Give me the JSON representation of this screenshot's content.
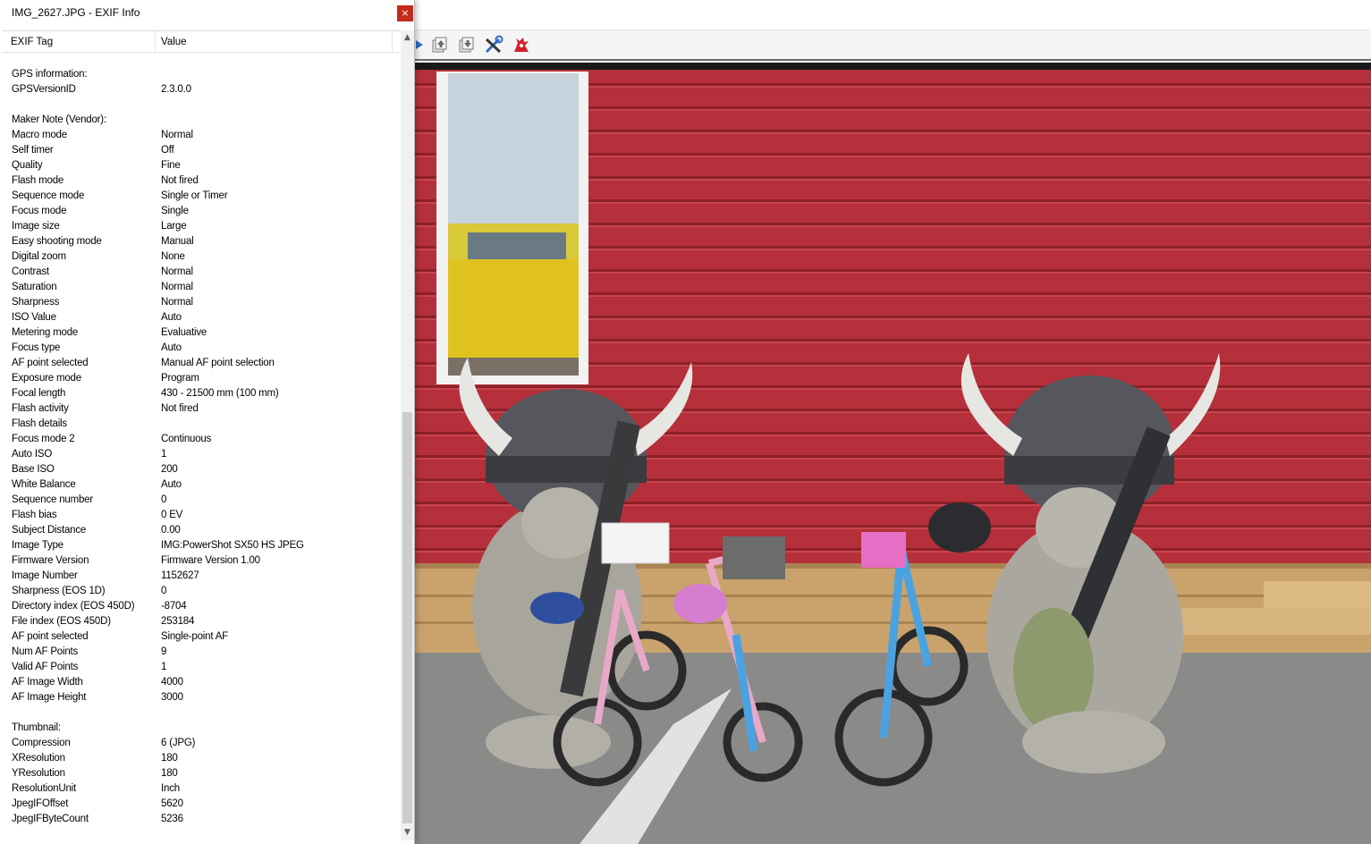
{
  "dialog": {
    "title": "IMG_2627.JPG - EXIF Info",
    "close_glyph": "×"
  },
  "columns": {
    "tag": "EXIF Tag",
    "value": "Value"
  },
  "rows": [
    {
      "tag": "",
      "value": ""
    },
    {
      "tag": "GPS information:",
      "value": ""
    },
    {
      "tag": "GPSVersionID",
      "value": "2.3.0.0"
    },
    {
      "tag": "",
      "value": ""
    },
    {
      "tag": "Maker Note (Vendor):",
      "value": ""
    },
    {
      "tag": "Macro mode",
      "value": "Normal"
    },
    {
      "tag": "Self timer",
      "value": "Off"
    },
    {
      "tag": "Quality",
      "value": "Fine"
    },
    {
      "tag": "Flash mode",
      "value": "Not fired"
    },
    {
      "tag": "Sequence mode",
      "value": "Single or Timer"
    },
    {
      "tag": "Focus mode",
      "value": "Single"
    },
    {
      "tag": "Image size",
      "value": "Large"
    },
    {
      "tag": "Easy shooting mode",
      "value": "Manual"
    },
    {
      "tag": "Digital zoom",
      "value": "None"
    },
    {
      "tag": "Contrast",
      "value": "Normal"
    },
    {
      "tag": "Saturation",
      "value": "Normal"
    },
    {
      "tag": "Sharpness",
      "value": "Normal"
    },
    {
      "tag": "ISO Value",
      "value": "Auto"
    },
    {
      "tag": "Metering mode",
      "value": "Evaluative"
    },
    {
      "tag": "Focus type",
      "value": "Auto"
    },
    {
      "tag": "AF point selected",
      "value": "Manual AF point selection"
    },
    {
      "tag": "Exposure mode",
      "value": "Program"
    },
    {
      "tag": "Focal length",
      "value": "430 - 21500 mm (100 mm)"
    },
    {
      "tag": "Flash activity",
      "value": "Not fired"
    },
    {
      "tag": "Flash details",
      "value": ""
    },
    {
      "tag": "Focus mode 2",
      "value": "Continuous"
    },
    {
      "tag": "Auto ISO",
      "value": "1"
    },
    {
      "tag": "Base ISO",
      "value": "200"
    },
    {
      "tag": "White Balance",
      "value": "Auto"
    },
    {
      "tag": "Sequence number",
      "value": "0"
    },
    {
      "tag": "Flash bias",
      "value": "0 EV"
    },
    {
      "tag": "Subject Distance",
      "value": "0.00"
    },
    {
      "tag": "Image Type",
      "value": "IMG:PowerShot SX50 HS JPEG"
    },
    {
      "tag": "Firmware Version",
      "value": "Firmware Version 1.00"
    },
    {
      "tag": "Image Number",
      "value": "1152627"
    },
    {
      "tag": "Sharpness (EOS 1D)",
      "value": "0"
    },
    {
      "tag": "Directory index (EOS 450D)",
      "value": "-8704"
    },
    {
      "tag": "File index (EOS 450D)",
      "value": "253184"
    },
    {
      "tag": "AF point selected",
      "value": "Single-point AF"
    },
    {
      "tag": "Num AF Points",
      "value": "9"
    },
    {
      "tag": "Valid AF Points",
      "value": "1"
    },
    {
      "tag": "AF Image Width",
      "value": "4000"
    },
    {
      "tag": "AF Image Height",
      "value": "3000"
    },
    {
      "tag": "",
      "value": ""
    },
    {
      "tag": "Thumbnail:",
      "value": ""
    },
    {
      "tag": "Compression",
      "value": "6 (JPG)"
    },
    {
      "tag": "XResolution",
      "value": "180"
    },
    {
      "tag": "YResolution",
      "value": "180"
    },
    {
      "tag": "ResolutionUnit",
      "value": "Inch"
    },
    {
      "tag": "JpegIFOffset",
      "value": "5620"
    },
    {
      "tag": "JpegIFByteCount",
      "value": "5236"
    }
  ],
  "scrollbar": {
    "up_glyph": "▲",
    "down_glyph": "▼"
  },
  "toolbar_icons": [
    "play-icon",
    "move-up-icon",
    "move-down-icon",
    "tools-icon",
    "exit-icon"
  ],
  "colors": {
    "wall": "#b5303a",
    "close_button": "#c42b1c"
  }
}
